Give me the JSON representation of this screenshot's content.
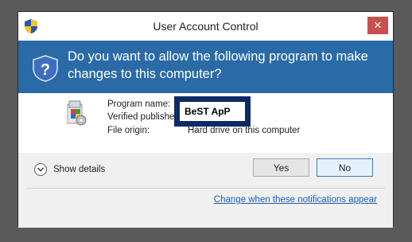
{
  "window": {
    "title": "User Account Control",
    "close_glyph": "✕"
  },
  "banner": {
    "question": "Do you want to allow the following program to make changes to this computer?"
  },
  "details": {
    "program_name_label": "Program name:",
    "verified_publisher_label": "Verified publishe",
    "file_origin_label": "File origin:",
    "file_origin_value": "Hard drive on this computer",
    "redaction_text": "BeST ApP"
  },
  "footer": {
    "show_details_label": "Show details",
    "yes_label": "Yes",
    "no_label": "No",
    "notifications_link": "Change when these notifications appear"
  },
  "colors": {
    "banner": "#2a6aa6",
    "close": "#c75050",
    "link": "#1a5fb4",
    "redaction_border": "#0d2a66"
  },
  "icons": {
    "title": "uac-shield-icon",
    "banner": "uac-shield-icon",
    "program": "program-installer-icon",
    "details": "chevron-down-icon"
  }
}
